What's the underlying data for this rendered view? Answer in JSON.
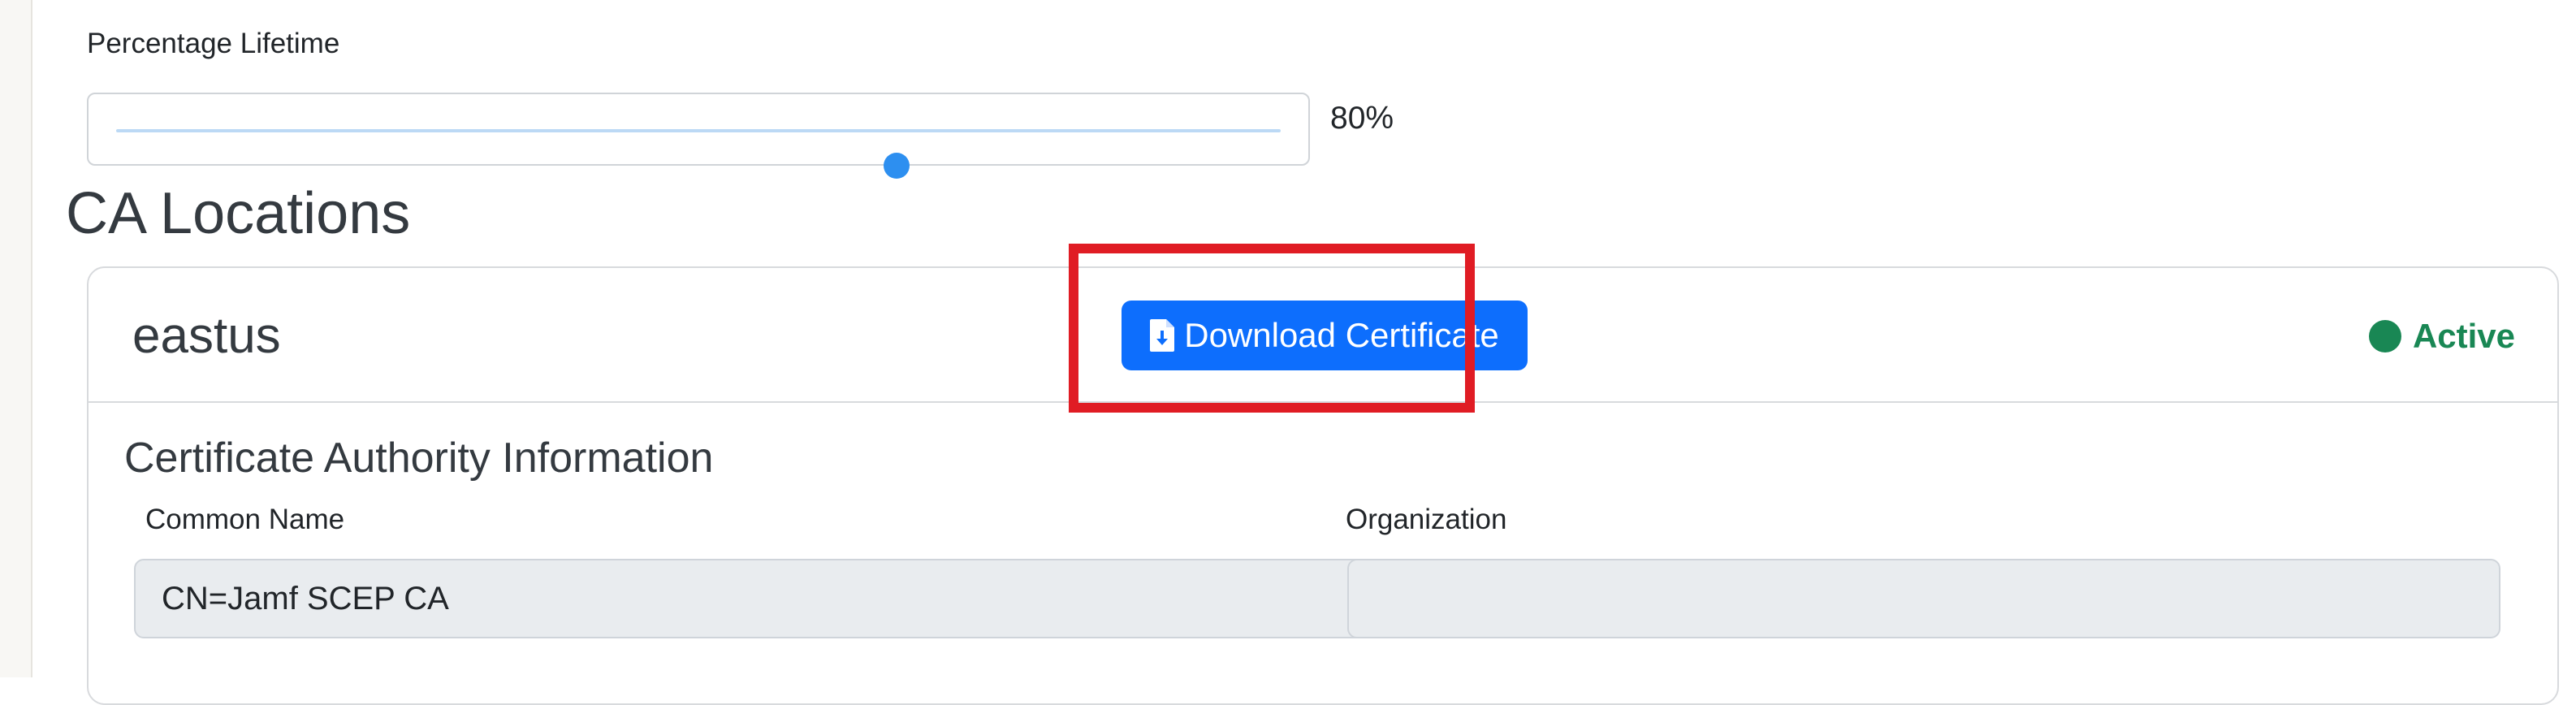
{
  "lifetime": {
    "label": "Percentage Lifetime",
    "value": 0.67,
    "value_text": "80%"
  },
  "ca_locations": {
    "title": "CA Locations",
    "card": {
      "region": "eastus",
      "download_label": "Download Certificate",
      "status": "Active",
      "info_title": "Certificate Authority Information",
      "common_name": {
        "label": "Common Name",
        "value": "CN=Jamf SCEP CA"
      },
      "organization": {
        "label": "Organization",
        "value": ""
      }
    }
  },
  "colors": {
    "primary": "#0d6efd",
    "success": "#198754",
    "highlight": "#e01c24",
    "slider_thumb": "#2d8ff0"
  },
  "icons": {
    "download": "file-download-icon",
    "status": "status-dot-icon"
  }
}
